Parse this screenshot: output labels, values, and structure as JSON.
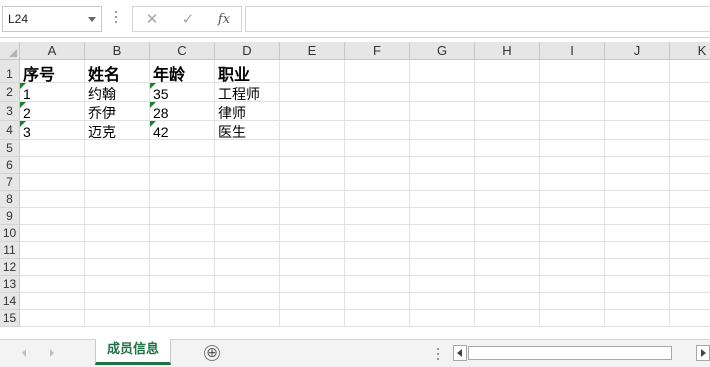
{
  "formula_bar": {
    "name_box": "L24",
    "cancel_icon": "✕",
    "enter_icon": "✓",
    "fx_icon": "fx",
    "formula": ""
  },
  "grid": {
    "columns": [
      "A",
      "B",
      "C",
      "D",
      "E",
      "F",
      "G",
      "H",
      "I",
      "J",
      "K"
    ],
    "rows": [
      "1",
      "2",
      "3",
      "4",
      "5",
      "6",
      "7",
      "8",
      "9",
      "10",
      "11",
      "12",
      "13",
      "14",
      "15"
    ],
    "cells": {
      "A1": "序号",
      "B1": "姓名",
      "C1": "年龄",
      "D1": "职业",
      "A2": "1",
      "B2": "约翰",
      "C2": "35",
      "D2": "工程师",
      "A3": "2",
      "B3": "乔伊",
      "C3": "28",
      "D3": "律师",
      "A4": "3",
      "B4": "迈克",
      "C4": "42",
      "D4": "医生"
    },
    "text_number_flags": [
      "A2",
      "A3",
      "A4",
      "C2",
      "C3",
      "C4"
    ],
    "flag_color": "#1e7e34"
  },
  "sheet_tabs": {
    "active": "成员信息",
    "accent_color": "#217346",
    "add_icon": "⊕"
  }
}
